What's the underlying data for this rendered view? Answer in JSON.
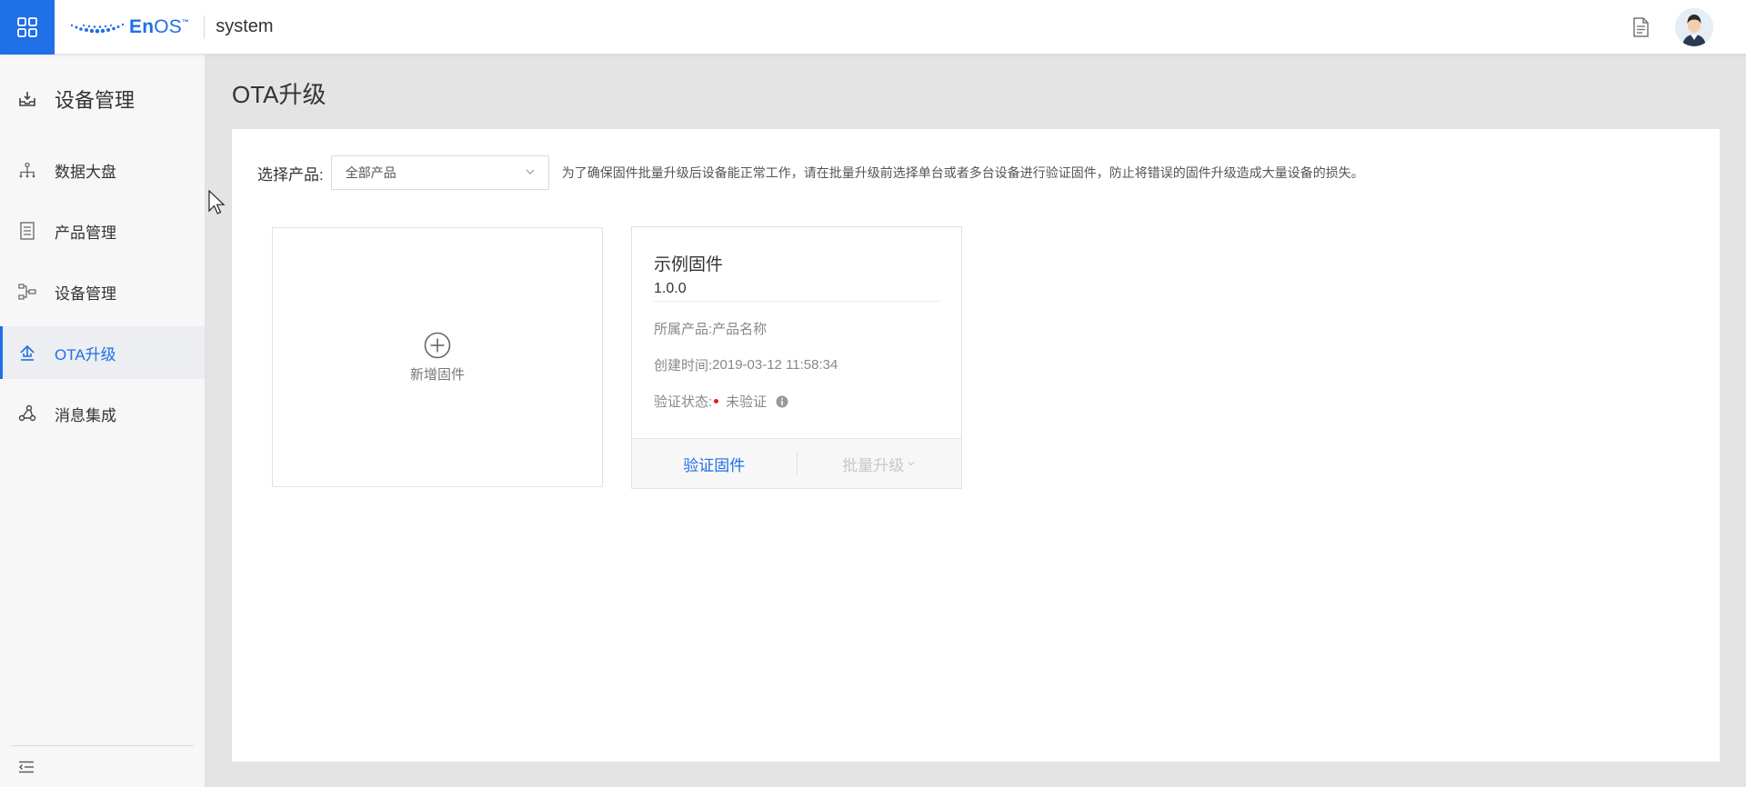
{
  "header": {
    "logo_text_en": "En",
    "logo_text_os": "OS",
    "logo_tm": "™",
    "title": "system",
    "brand_color": "#1f6fe6",
    "icons": [
      "app-grid-icon",
      "document-icon",
      "user-avatar"
    ]
  },
  "sidebar": {
    "header_label": "设备管理",
    "items": [
      {
        "label": "数据大盘",
        "icon": "dashboard-icon",
        "active": false
      },
      {
        "label": "产品管理",
        "icon": "product-icon",
        "active": false
      },
      {
        "label": "设备管理",
        "icon": "device-icon",
        "active": false
      },
      {
        "label": "OTA升级",
        "icon": "upload-icon",
        "active": true
      },
      {
        "label": "消息集成",
        "icon": "integration-icon",
        "active": false
      }
    ],
    "collapse_icon": "collapse-menu-icon"
  },
  "main": {
    "page_title": "OTA升级",
    "filter": {
      "label": "选择产品:",
      "selected": "全部产品",
      "hint": "为了确保固件批量升级后设备能正常工作，请在批量升级前选择单台或者多台设备进行验证固件，防止将错误的固件升级造成大量设备的损失。"
    },
    "add_card": {
      "label": "新增固件"
    },
    "firmware_card": {
      "name": "示例固件",
      "version": "1.0.0",
      "product_label": "所属产品:",
      "product_value": "产品名称",
      "created_label": "创建时间:",
      "created_value": "2019-03-12 11:58:34",
      "status_label": "验证状态:",
      "status_value": "未验证",
      "status_color": "#e02020",
      "verify_button": "验证固件",
      "batch_button": "批量升级"
    }
  }
}
